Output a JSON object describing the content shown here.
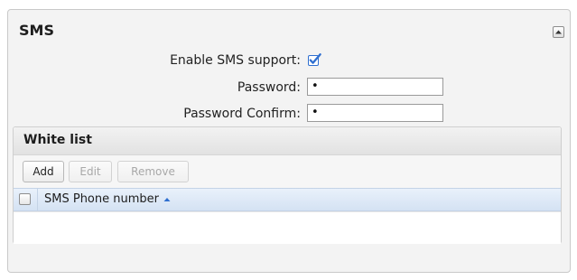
{
  "panel": {
    "title": "SMS"
  },
  "form": {
    "enable_label": "Enable SMS support:",
    "enable_checked": true,
    "password_label": "Password:",
    "password_value": "•",
    "password_confirm_label": "Password Confirm:",
    "password_confirm_value": "•"
  },
  "whitelist": {
    "title": "White list",
    "toolbar": {
      "add_label": "Add",
      "edit_label": "Edit",
      "remove_label": "Remove"
    },
    "columns": [
      {
        "label": "SMS Phone number",
        "sort": "ascending"
      }
    ],
    "rows": []
  },
  "icons": {
    "collapse": "collapse-up-icon",
    "sort": "sort-ascending-icon"
  },
  "colors": {
    "check_blue": "#2f6fd0",
    "header_blue": "#d4e2f3"
  }
}
